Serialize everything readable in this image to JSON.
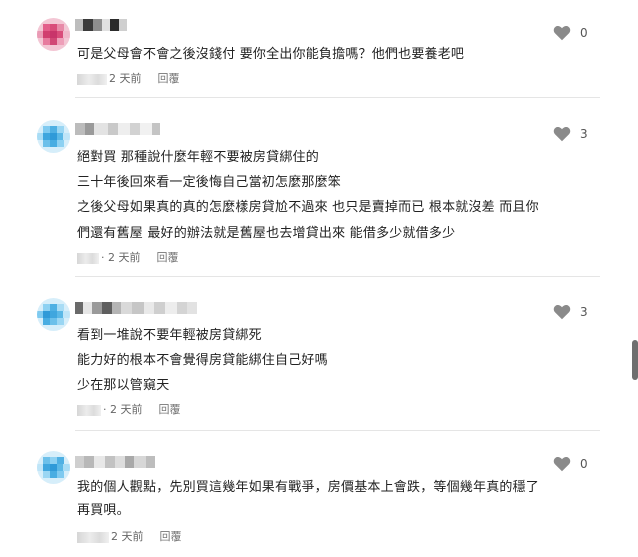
{
  "comments": [
    {
      "lines": [
        "可是父母會不會之後沒錢付 要你全出你能負擔嗎？他們也要養老吧"
      ],
      "time": "2 天前",
      "reply_label": "回覆",
      "likes": "0",
      "avatar_color": "#d94c7a"
    },
    {
      "lines": [
        "絕對買 那種說什麼年輕不要被房貸綁住的",
        "三十年後回來看一定後悔自己當初怎麼那麼笨",
        "之後父母如果真的真的怎麼樣房貸尬不過來 也只是賣掉而已 根本就沒差 而且你",
        "們還有舊屋 最好的辦法就是舊屋也去增貸出來 能借多少就借多少"
      ],
      "time": "· 2 天前",
      "reply_label": "回覆",
      "likes": "3",
      "avatar_color": "#5bb8e6"
    },
    {
      "lines": [
        "看到一堆說不要年輕被房貸綁死",
        "能力好的根本不會覺得房貸能綁住自己好嗎",
        "少在那以管窺天"
      ],
      "time": "· 2 天前",
      "reply_label": "回覆",
      "likes": "3",
      "avatar_color": "#5bb8e6"
    },
    {
      "lines": [
        "我的個人觀點，先別買這幾年如果有戰爭，房價基本上會跌，等個幾年真的穩了",
        "再買唄。"
      ],
      "time": "2 天前",
      "reply_label": "回覆",
      "likes": "0",
      "avatar_color": "#5bb8e6"
    }
  ],
  "icons": {
    "like": "heart-icon",
    "avatar": "pixelated-avatar-icon"
  },
  "colors": {
    "heart": "#8a8a8a",
    "divider": "#e5e5e5",
    "scroll_thumb": "#6f6f6f"
  }
}
